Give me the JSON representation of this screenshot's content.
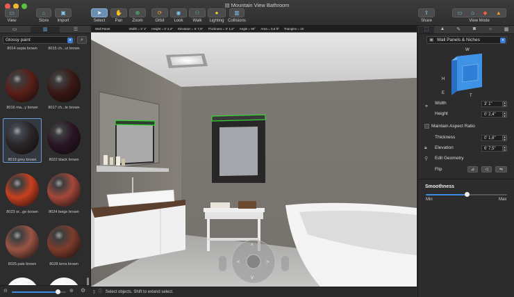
{
  "window": {
    "title": "Mountain View Bathroom"
  },
  "toolbar": {
    "buttons": [
      {
        "label": "View",
        "icon": "view-icon"
      },
      {
        "label": "Store",
        "icon": "store-icon"
      },
      {
        "label": "Import",
        "icon": "import-icon"
      },
      {
        "label": "Select",
        "icon": "select-icon"
      },
      {
        "label": "Pan",
        "icon": "pan-icon"
      },
      {
        "label": "Zoom",
        "icon": "zoom-icon"
      },
      {
        "label": "Orbit",
        "icon": "orbit-icon"
      },
      {
        "label": "Look",
        "icon": "look-icon"
      },
      {
        "label": "Walk",
        "icon": "walk-icon"
      },
      {
        "label": "Lighting",
        "icon": "lighting-icon"
      },
      {
        "label": "Collisions",
        "icon": "collisions-icon"
      },
      {
        "label": "Share",
        "icon": "share-icon"
      },
      {
        "label": "View Mode",
        "icon": "view-mode-icon"
      }
    ]
  },
  "left_panel": {
    "material_category": "Glossy paint",
    "top_labels": [
      "8014 sepia brown",
      "8015 ch...ut brown"
    ],
    "materials": [
      {
        "label": "8016 ma...y brown",
        "color": "#5a1f18"
      },
      {
        "label": "8017 ch...te brown",
        "color": "#3a1815"
      },
      {
        "label": "8019 grey brown",
        "color": "#2a2526"
      },
      {
        "label": "8022 black brown",
        "color": "#2a1525"
      },
      {
        "label": "8023 or...ge brown",
        "color": "#c8401f"
      },
      {
        "label": "8024 beige brown",
        "color": "#a4483a"
      },
      {
        "label": "8025 pale brown",
        "color": "#9a5444"
      },
      {
        "label": "8028 terra brown",
        "color": "#7e3c2b"
      }
    ],
    "zoom_level": 0.85
  },
  "viewport": {
    "info_bar": [
      "Wall Panel",
      "Width = 3' 1\"",
      "Height = 0' 2,4\"",
      "Elevation = 6' 7,5\"",
      "Thickness = 0' 1,6\"",
      "Angle = 90°",
      "Area = 0,6 ft²",
      "Triangles = 10"
    ]
  },
  "status_bar": {
    "text": "Select objects. Shift to extend select."
  },
  "right_panel": {
    "object_type": "Wall Panels & Niches",
    "diagram_labels": {
      "w": "W",
      "h": "H",
      "e": "E",
      "t": "T"
    },
    "properties": {
      "width_label": "Width",
      "width_value": "3' 1\"",
      "height_label": "Height",
      "height_value": "0' 2,4\"",
      "maintain_aspect": "Maintain Aspect Ratio",
      "thickness_label": "Thickness",
      "thickness_value": "0' 1,6\"",
      "elevation_label": "Elevation",
      "elevation_value": "6' 7,5\"",
      "edit_geometry": "Edit Geometry",
      "flip_label": "Flip"
    },
    "smoothness": {
      "title": "Smoothness",
      "min": "Min",
      "max": "Max",
      "value": 0.5
    }
  }
}
